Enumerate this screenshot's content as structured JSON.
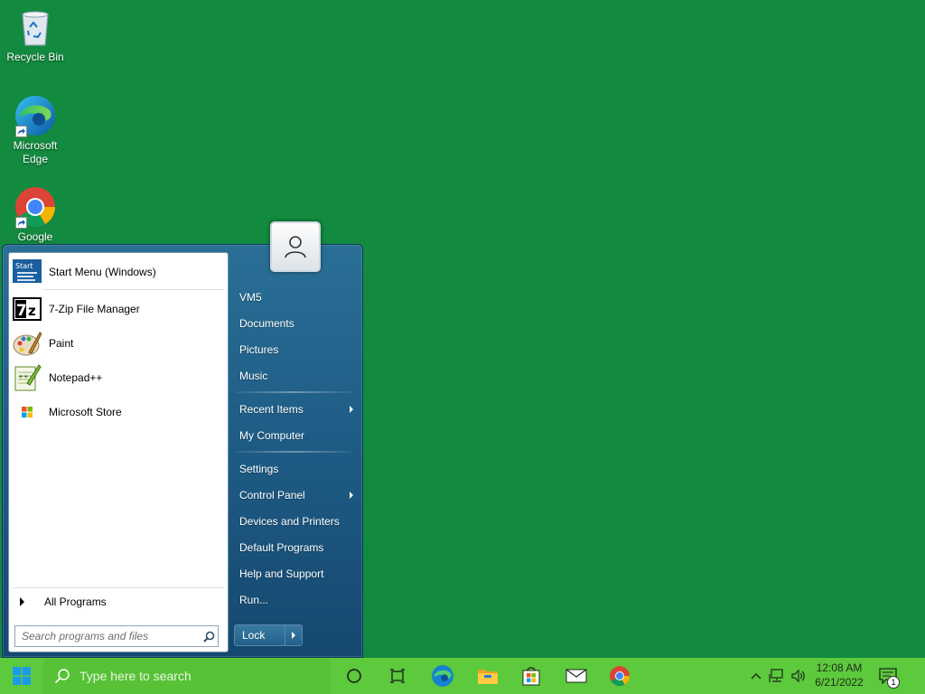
{
  "desktop": {
    "background": "#128a3f",
    "icons": [
      {
        "label": "Recycle Bin",
        "icon": "recycle-bin-icon"
      },
      {
        "label": "Microsoft Edge",
        "icon": "edge-icon"
      },
      {
        "label": "Google",
        "icon": "chrome-icon"
      }
    ]
  },
  "start_menu": {
    "pinned": [
      {
        "label": "Start Menu (Windows)",
        "icon": "start-menu-app-icon"
      }
    ],
    "recent_programs": [
      {
        "label": "7-Zip File Manager",
        "icon": "7zip-icon"
      },
      {
        "label": "Paint",
        "icon": "paint-icon"
      },
      {
        "label": "Notepad++",
        "icon": "notepadpp-icon"
      },
      {
        "label": "Microsoft Store",
        "icon": "store-icon"
      }
    ],
    "all_programs_label": "All Programs",
    "search_placeholder": "Search programs and files",
    "right_items": [
      {
        "label": "VM5"
      },
      {
        "label": "Documents"
      },
      {
        "label": "Pictures"
      },
      {
        "label": "Music"
      },
      {
        "label": "Recent Items",
        "submenu": true
      },
      {
        "label": "My Computer"
      },
      {
        "label": "Settings"
      },
      {
        "label": "Control Panel",
        "submenu": true
      },
      {
        "label": "Devices and Printers"
      },
      {
        "label": "Default Programs"
      },
      {
        "label": "Help and Support"
      },
      {
        "label": "Run..."
      }
    ],
    "lock_label": "Lock",
    "colors": {
      "panel": "#1f5d86",
      "accent": "#2a6f96"
    }
  },
  "taskbar": {
    "color": "#5dc93c",
    "search_placeholder": "Type here to search",
    "pinned": [
      "cortana-icon",
      "task-view-icon",
      "edge-icon",
      "file-explorer-icon",
      "store-icon",
      "mail-icon",
      "chrome-icon"
    ],
    "clock": {
      "time": "12:08 AM",
      "date": "6/21/2022"
    },
    "notification_count": "1"
  }
}
